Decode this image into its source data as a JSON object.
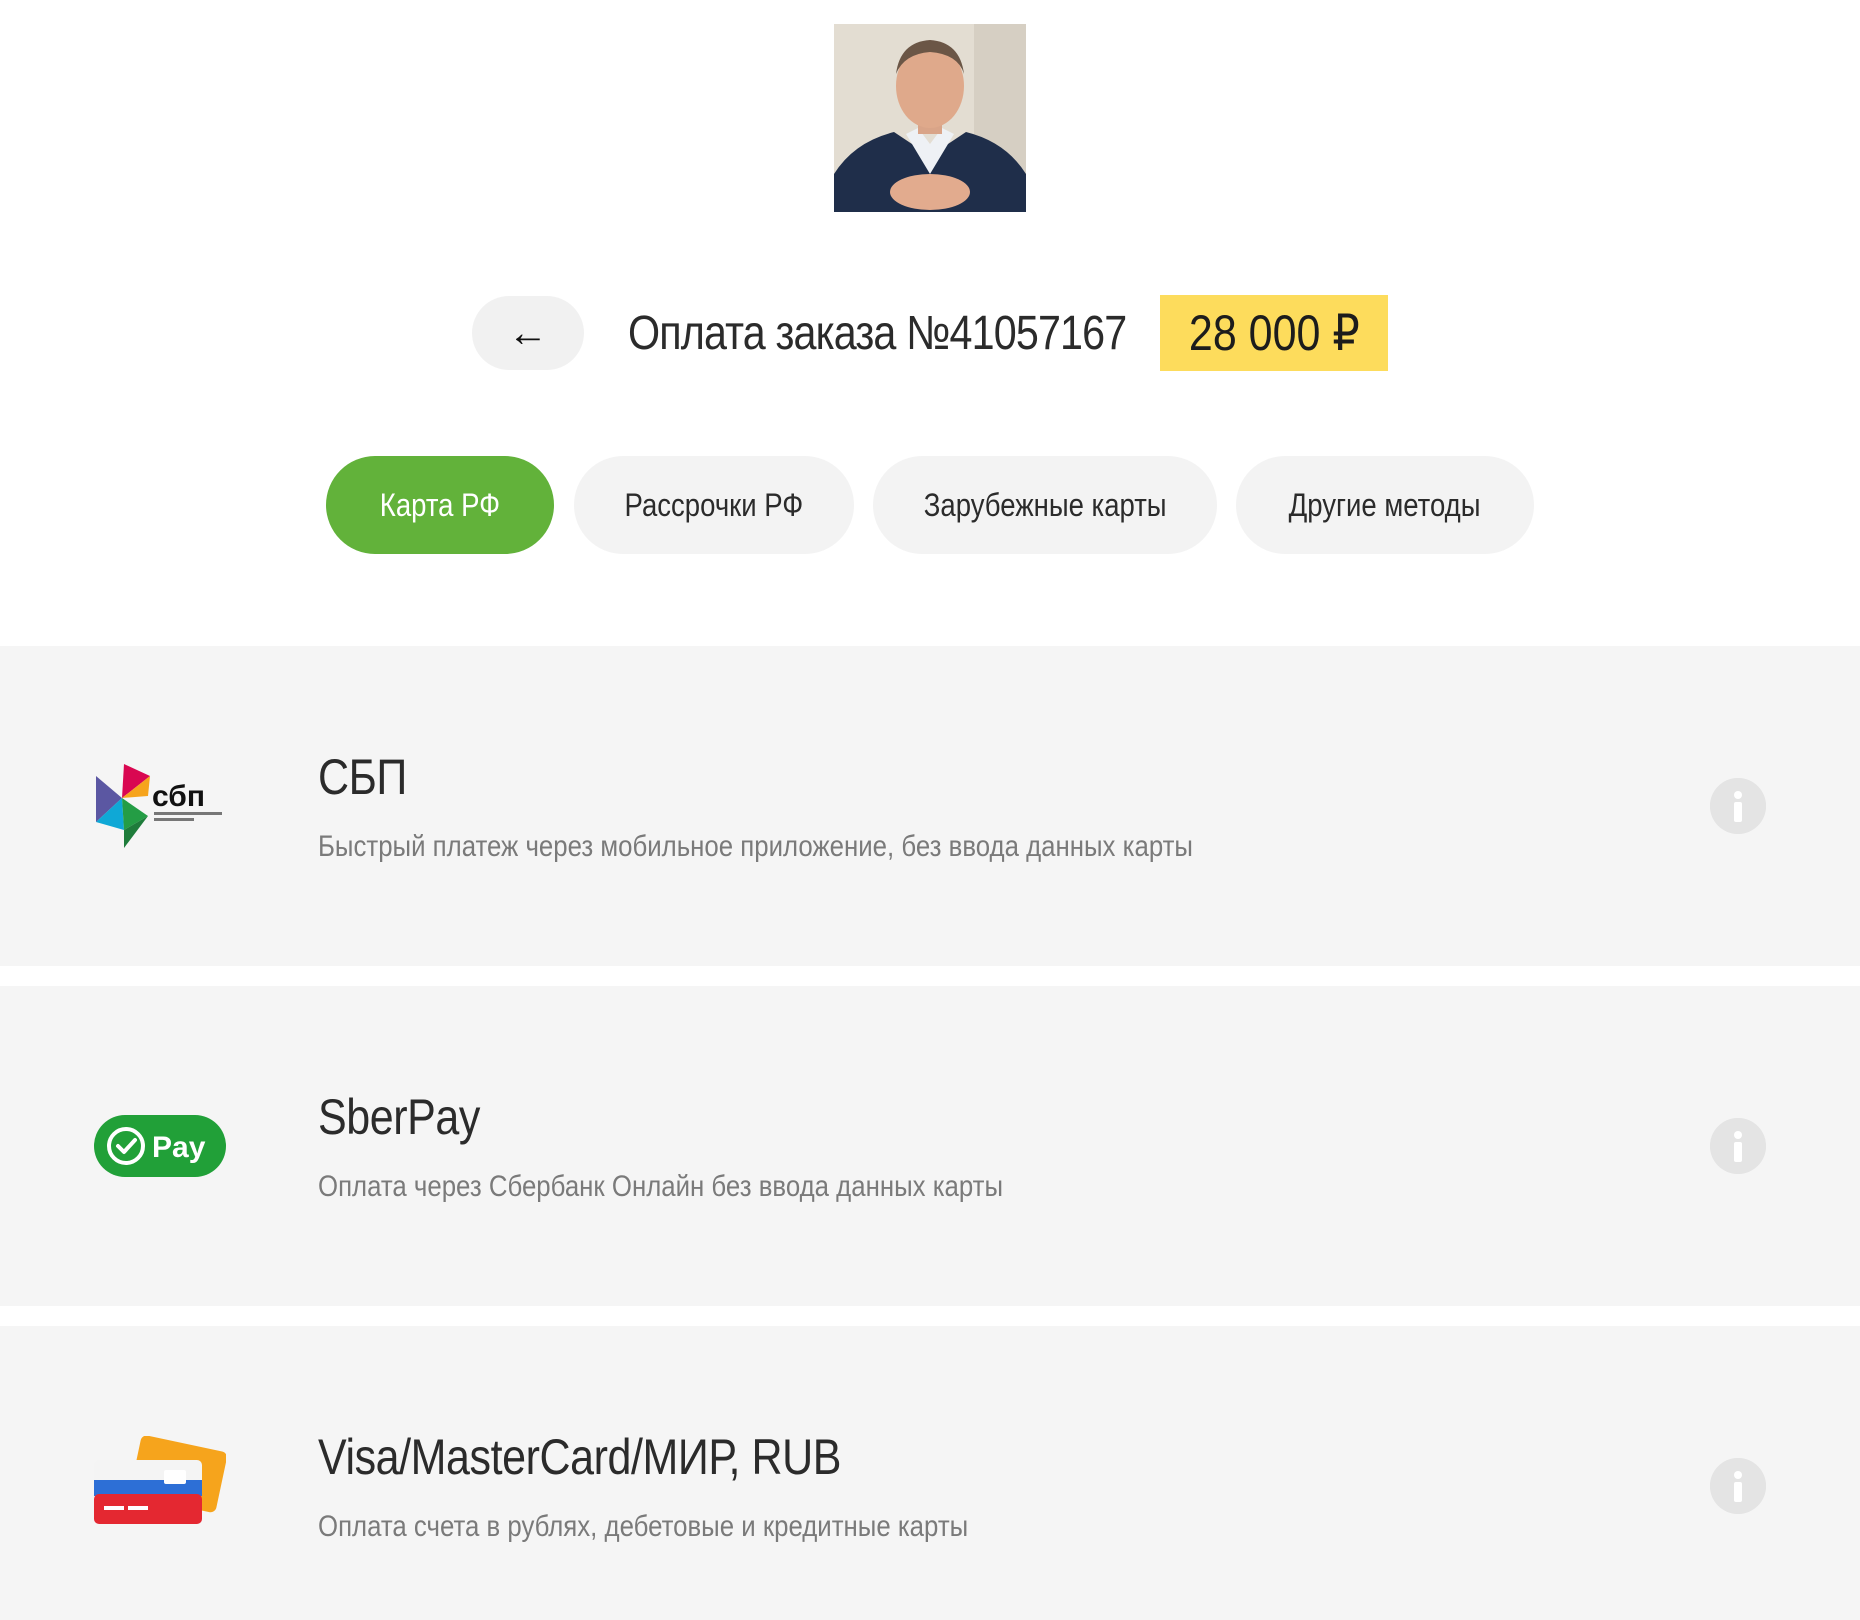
{
  "header": {
    "back_label": "←",
    "order_title": "Оплата заказа №41057167",
    "amount": "28 000 ₽"
  },
  "tabs": [
    {
      "label": "Карта РФ",
      "active": true
    },
    {
      "label": "Рассрочки РФ",
      "active": false
    },
    {
      "label": "Зарубежные карты",
      "active": false
    },
    {
      "label": "Другие методы",
      "active": false
    }
  ],
  "methods": [
    {
      "title": "СБП",
      "description": "Быстрый платеж через мобильное приложение, без ввода данных карты",
      "icon": "sbp-logo-icon"
    },
    {
      "title": "SberPay",
      "description": "Оплата через Сбербанк Онлайн без ввода данных карты",
      "icon": "sberpay-logo-icon"
    },
    {
      "title": "Visa/MasterCard/МИР, RUB",
      "description": "Оплата счета в рублях, дебетовые и кредитные карты",
      "icon": "bank-cards-icon"
    }
  ],
  "logos": {
    "sbp_text": "сбп",
    "sberpay_text": "Pay"
  },
  "colors": {
    "active_tab": "#62b23a",
    "amount_bg": "#fddc5c",
    "row_bg": "#f5f5f5",
    "tab_bg": "#f3f3f3"
  }
}
